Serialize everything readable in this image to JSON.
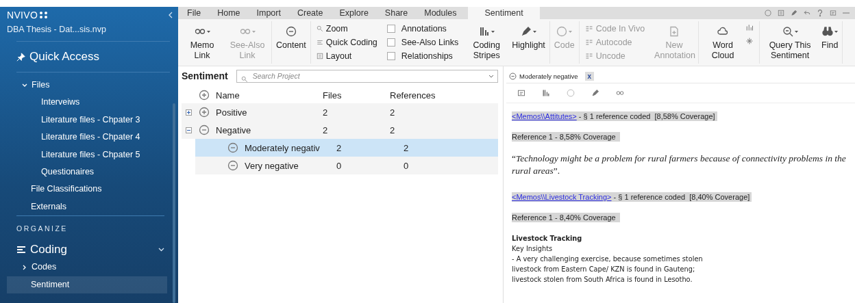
{
  "sidebar": {
    "app_name": "NVIVO",
    "project": "DBA Thesis - Dat...sis.nvp",
    "quick_access": "Quick Access",
    "tree": [
      {
        "label": "Files",
        "expanded": true,
        "selected": false,
        "children": [
          {
            "label": "Interveiws",
            "selected": false
          },
          {
            "label": "Literature files - Chpater 3",
            "selected": false
          },
          {
            "label": "Literature files - Chpater 4",
            "selected": false
          },
          {
            "label": "Literature files - Chpater 5",
            "selected": false
          },
          {
            "label": "Questionaires",
            "selected": false
          }
        ]
      },
      {
        "label": "File Classifications",
        "selected": false
      },
      {
        "label": "Externals",
        "selected": false
      }
    ],
    "section": "ORGANIZE",
    "group": {
      "label": "Coding",
      "expanded": true
    },
    "group_items": [
      {
        "label": "Codes",
        "expanded": false,
        "selected": false
      },
      {
        "label": "Sentiment",
        "selected": true
      }
    ]
  },
  "ribbon_tabs": [
    {
      "label": "File",
      "selected": false
    },
    {
      "label": "Home",
      "selected": false
    },
    {
      "label": "Import",
      "selected": false
    },
    {
      "label": "Create",
      "selected": false
    },
    {
      "label": "Explore",
      "selected": false
    },
    {
      "label": "Share",
      "selected": false
    },
    {
      "label": "Modules",
      "selected": false
    },
    {
      "label": "Sentiment",
      "selected": true
    }
  ],
  "ribbon": [
    {
      "kind": "big",
      "items": [
        {
          "label": "Memo Link",
          "disabled": false
        },
        {
          "label": "See-Also Link",
          "disabled": true
        }
      ]
    },
    {
      "kind": "big",
      "items": [
        {
          "label": "Content",
          "disabled": false
        }
      ]
    },
    {
      "kind": "stack",
      "items": [
        {
          "label": "Zoom",
          "disabled": false
        },
        {
          "label": "Quick Coding",
          "disabled": false
        },
        {
          "label": "Layout",
          "disabled": false
        }
      ]
    },
    {
      "kind": "checks",
      "items": [
        {
          "label": "Annotations",
          "checked": false
        },
        {
          "label": "See-Also Links",
          "checked": false
        },
        {
          "label": "Relationships",
          "checked": false
        }
      ]
    },
    {
      "kind": "big",
      "items": [
        {
          "label": "Coding Stripes",
          "disabled": false
        },
        {
          "label": "Highlight",
          "disabled": false
        }
      ]
    },
    {
      "kind": "big",
      "items": [
        {
          "label": "Code",
          "disabled": true
        }
      ]
    },
    {
      "kind": "stack",
      "items": [
        {
          "label": "Code In Vivo",
          "disabled": true
        },
        {
          "label": "Autocode",
          "disabled": true
        },
        {
          "label": "Uncode",
          "disabled": true
        }
      ]
    },
    {
      "kind": "big",
      "items": [
        {
          "label": "New Annotation",
          "disabled": true
        }
      ]
    },
    {
      "kind": "big",
      "items": [
        {
          "label": "Word Cloud",
          "disabled": false
        }
      ]
    },
    {
      "kind": "big",
      "items": [
        {
          "label": "Query This Sentiment",
          "disabled": false
        },
        {
          "label": "Find",
          "disabled": false
        }
      ]
    }
  ],
  "list_view": {
    "title": "Sentiment",
    "search": {
      "placeholder": "Search Project"
    },
    "columns": [
      "Name",
      "Files",
      "References"
    ],
    "rows": [
      {
        "name": "Positive",
        "files": "2",
        "references": "2",
        "kind": "positive",
        "expanded": false,
        "selected": false
      },
      {
        "name": "Negative",
        "files": "2",
        "references": "2",
        "kind": "negative",
        "expanded": true,
        "selected": false,
        "children": [
          {
            "name": "Moderately negativ",
            "files": "2",
            "references": "2",
            "kind": "negative",
            "selected": true
          },
          {
            "name": "Very negative",
            "files": "0",
            "references": "0",
            "kind": "negative",
            "selected": false
          }
        ]
      }
    ]
  },
  "detail": {
    "tab": {
      "label": "Moderately negative",
      "close": "x"
    },
    "blocks": [
      {
        "kind": "header",
        "link": "<Memos\\\\Attitutes>",
        "text": " - § 1 reference coded  [8,58% Coverage]"
      },
      {
        "kind": "ref",
        "text": "Reference 1 - 8,58% Coverage"
      },
      {
        "kind": "quote",
        "text": "“*Technology might be a problem for rural farmers because of connectivity problems in the rural areas*”."
      },
      {
        "kind": "header",
        "link": "<Memos\\\\Livestock Tracking>",
        "text": " - § 1 reference coded  [8,40% Coverage]"
      },
      {
        "kind": "ref",
        "text": "Reference 1 - 8,40% Coverage"
      },
      {
        "kind": "memo",
        "title": "Livestock Tracking",
        "lines": [
          "Key Insights",
          "- A very challenging exercise, because sometimes stolen",
          "livestock from Eastern Cape/ KZN is found in Gauteng;",
          "livestock stolen from South Africa is found in Lesotho."
        ]
      }
    ]
  }
}
